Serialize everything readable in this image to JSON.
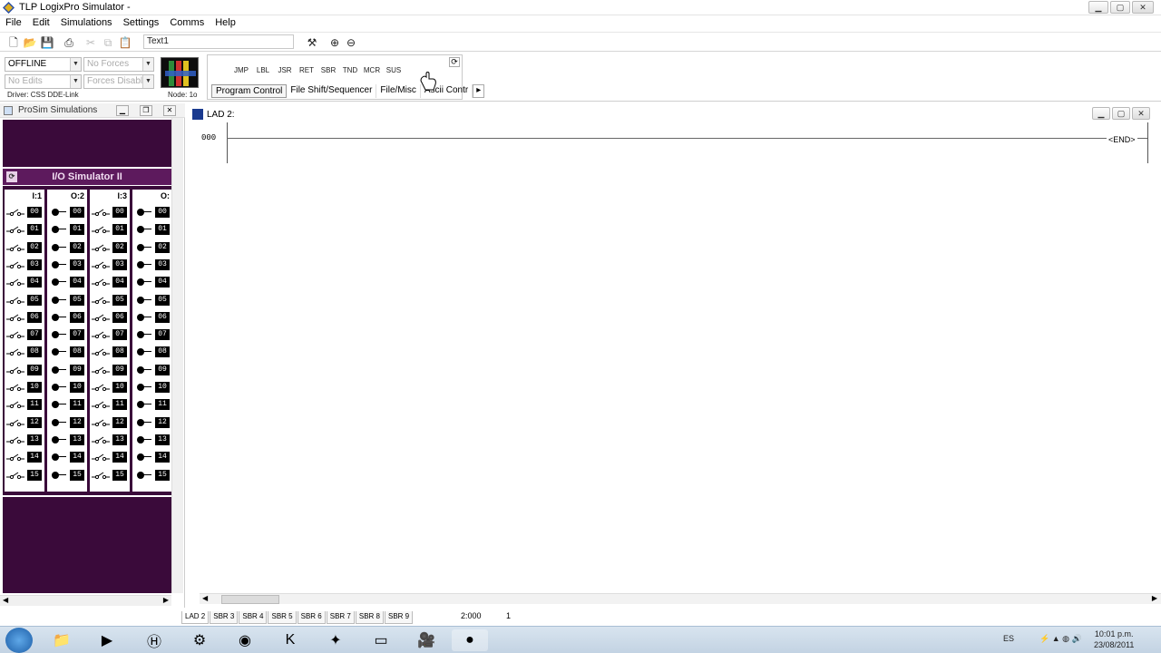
{
  "window": {
    "title": "TLP LogixPro Simulator -"
  },
  "menu": [
    "File",
    "Edit",
    "Simulations",
    "Settings",
    "Comms",
    "Help"
  ],
  "toolbar": {
    "text_combo_value": "Text1"
  },
  "mode": {
    "status_value": "OFFLINE",
    "edits_value": "No Edits",
    "forces_value": "No Forces",
    "forces_state_value": "Forces Disabled",
    "driver_label": "Driver: CSS DDE-Link",
    "node_label": "Node: 1o"
  },
  "instructions": {
    "buttons": [
      "JMP",
      "LBL",
      "JSR",
      "RET",
      "SBR",
      "TND",
      "MCR",
      "SUS"
    ],
    "tabs": [
      "Program Control",
      "File Shift/Sequencer",
      "File/Misc",
      "Ascii Contr"
    ]
  },
  "prosim": {
    "title": "ProSim Simulations",
    "io_title": "I/O Simulator II",
    "columns": [
      {
        "head": "I:1",
        "kind": "input"
      },
      {
        "head": "O:2",
        "kind": "output"
      },
      {
        "head": "I:3",
        "kind": "input"
      },
      {
        "head": "O:",
        "kind": "output"
      }
    ],
    "rows": [
      "00",
      "01",
      "02",
      "03",
      "04",
      "05",
      "06",
      "07",
      "08",
      "09",
      "10",
      "11",
      "12",
      "13",
      "14",
      "15"
    ]
  },
  "lad": {
    "title": "LAD 2:",
    "rung_number": "000",
    "end_label": "END"
  },
  "file_tabs": [
    "LAD 2",
    "SBR 3",
    "SBR 4",
    "SBR 5",
    "SBR 6",
    "SBR 7",
    "SBR 8",
    "SBR 9"
  ],
  "status": {
    "position": "2:000",
    "value": "1"
  },
  "taskbar": {
    "language": "ES",
    "time": "10:01 p.m.",
    "date": "23/08/2011"
  }
}
